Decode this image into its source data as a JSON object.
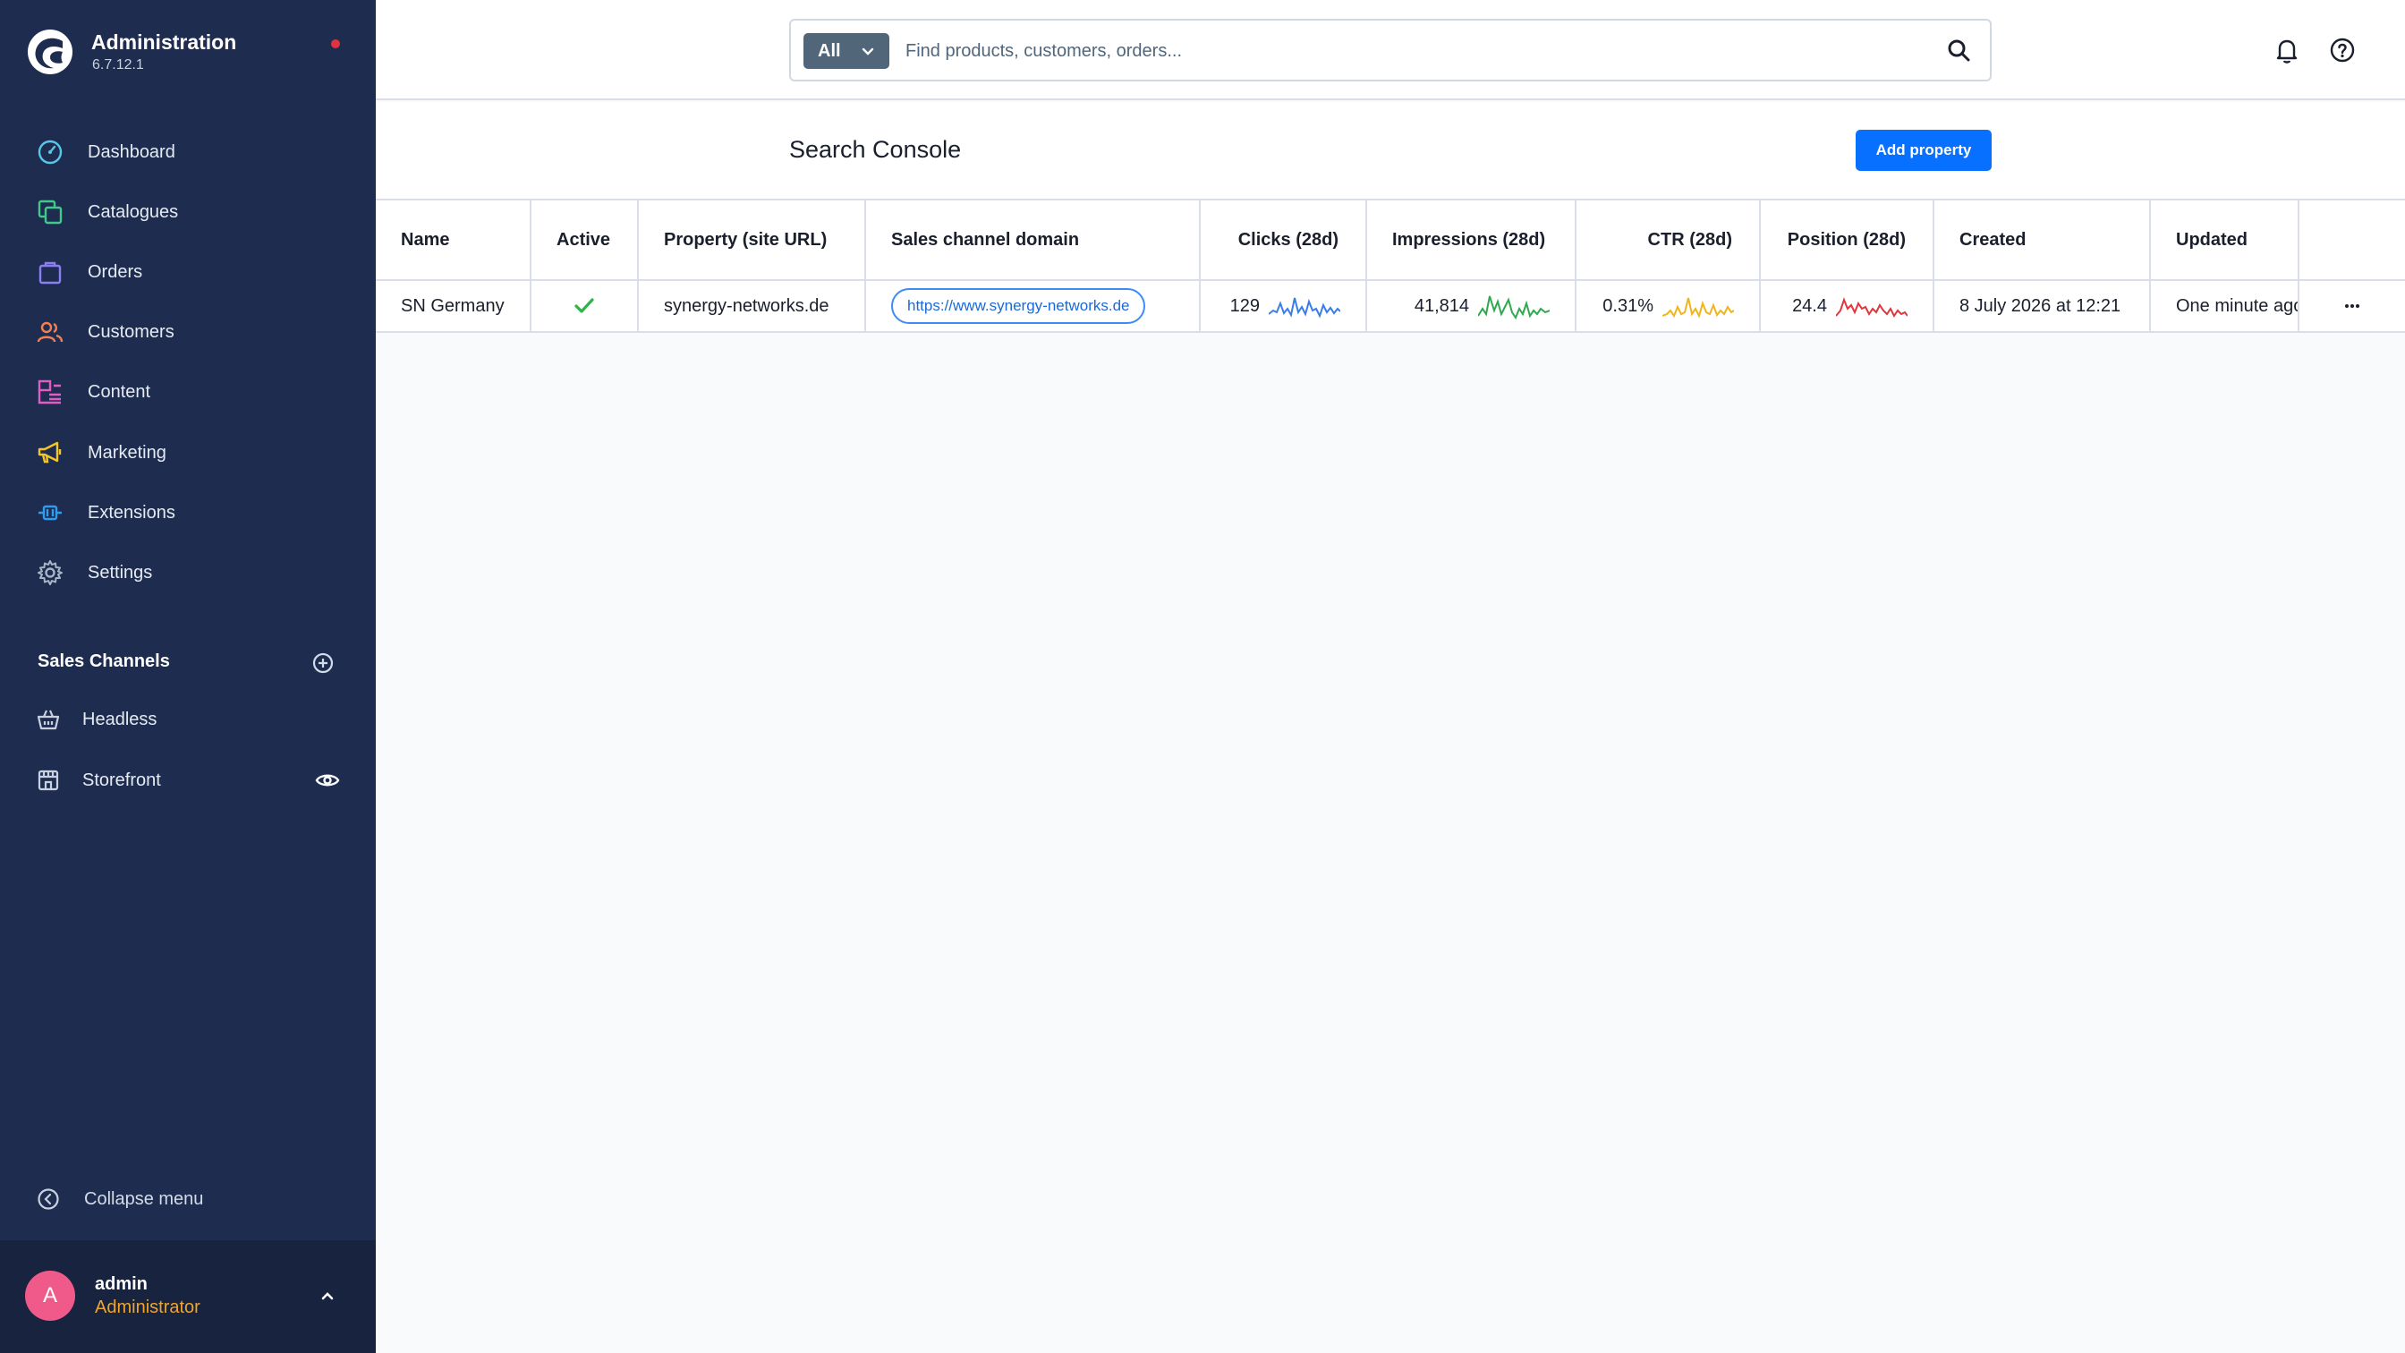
{
  "brand": {
    "title": "Administration",
    "version": "6.7.12.1"
  },
  "nav": {
    "items": [
      {
        "label": "Dashboard",
        "icon": "gauge-icon",
        "color": "#58c6e6"
      },
      {
        "label": "Catalogues",
        "icon": "catalogue-icon",
        "color": "#41c98a"
      },
      {
        "label": "Orders",
        "icon": "shopping-bag-icon",
        "color": "#8a7ef5"
      },
      {
        "label": "Customers",
        "icon": "users-icon",
        "color": "#f27f52"
      },
      {
        "label": "Content",
        "icon": "content-list-icon",
        "color": "#e25cc4"
      },
      {
        "label": "Marketing",
        "icon": "megaphone-icon",
        "color": "#f5c523"
      },
      {
        "label": "Extensions",
        "icon": "plug-icon",
        "color": "#2f9cf0"
      },
      {
        "label": "Settings",
        "icon": "gear-icon",
        "color": "#a9b4c7"
      }
    ]
  },
  "sales_channels": {
    "title": "Sales Channels",
    "items": [
      {
        "label": "Headless",
        "icon": "basket-icon"
      },
      {
        "label": "Storefront",
        "icon": "storefront-icon"
      }
    ]
  },
  "collapse": {
    "label": "Collapse menu"
  },
  "user": {
    "initial": "A",
    "name": "admin",
    "role": "Administrator"
  },
  "search": {
    "scope": "All",
    "placeholder": "Find products, customers, orders..."
  },
  "page": {
    "title": "Search Console",
    "add_button": "Add property"
  },
  "table": {
    "headers": {
      "name": "Name",
      "active": "Active",
      "property": "Property (site URL)",
      "domain": "Sales channel domain",
      "clicks": "Clicks (28d)",
      "impressions": "Impressions (28d)",
      "ctr": "CTR (28d)",
      "position": "Position (28d)",
      "created": "Created",
      "updated": "Updated"
    },
    "rows": [
      {
        "name": "SN Germany",
        "active": true,
        "property": "synergy-networks.de",
        "domain": "https://www.synergy-networks.de",
        "clicks": "129",
        "impressions": "41,814",
        "ctr": "0.31%",
        "position": "24.4",
        "created": "8 July 2026 at 12:21",
        "updated": "One minute ago"
      }
    ]
  },
  "colors": {
    "sidebar": "#1e2d4f",
    "accent": "#0870ff",
    "active_check": "#2fb34a",
    "spark_clicks": "#3a7de8",
    "spark_impressions": "#2fa84f",
    "spark_ctr": "#f0b41c",
    "spark_position": "#e0363c"
  }
}
